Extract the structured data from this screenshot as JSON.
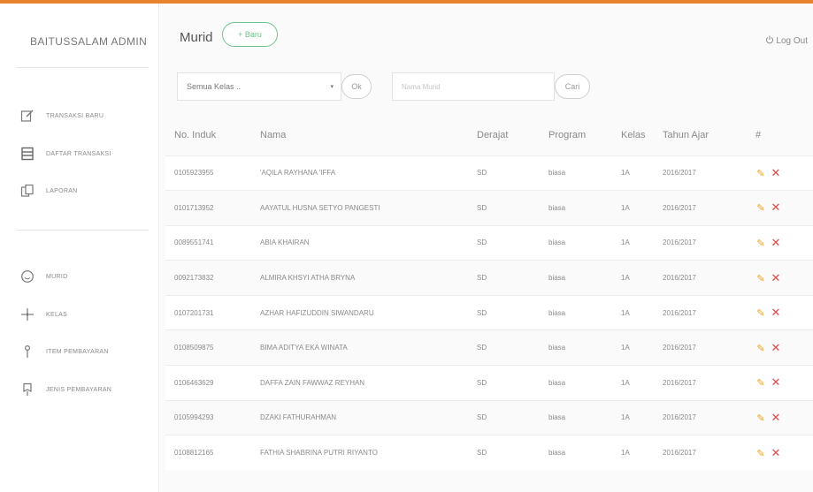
{
  "colors": {
    "accent": "#e8822e",
    "new_button": "#6dc48a",
    "edit": "#e8a21e",
    "delete": "#e04747"
  },
  "sidebar": {
    "brand": "BAITUSSALAM ADMIN",
    "items": [
      {
        "label": "TRANSAKSI BARU",
        "icon": "edit-document-icon"
      },
      {
        "label": "DAFTAR TRANSAKSI",
        "icon": "list-icon"
      },
      {
        "label": "LAPORAN",
        "icon": "report-icon"
      },
      {
        "label": "MURID",
        "icon": "smile-icon"
      },
      {
        "label": "KELAS",
        "icon": "class-icon"
      },
      {
        "label": "ITEM PEMBAYARAN",
        "icon": "pin-icon"
      },
      {
        "label": "JENIS PEMBAYARAN",
        "icon": "bookmark-icon"
      }
    ]
  },
  "header": {
    "title": "Murid",
    "new_button": "+ Baru",
    "logout": "Log Out"
  },
  "filters": {
    "class_select": "Semua Kelas ..",
    "ok_button": "Ok",
    "search_placeholder": "Nama Murid",
    "search_button": "Cari"
  },
  "table": {
    "headers": [
      "No. Induk",
      "Nama",
      "Derajat",
      "Program",
      "Kelas",
      "Tahun Ajar",
      "#"
    ],
    "rows": [
      {
        "no": "0105923955",
        "nama": "'AQILA RAYHANA 'IFFA",
        "derajat": "SD",
        "program": "biasa",
        "kelas": "1A",
        "tahun": "2016/2017"
      },
      {
        "no": "0101713952",
        "nama": "AAYATUL HUSNA SETYO PANGESTI",
        "derajat": "SD",
        "program": "biasa",
        "kelas": "1A",
        "tahun": "2016/2017"
      },
      {
        "no": "0089551741",
        "nama": "ABIA KHAIRAN",
        "derajat": "SD",
        "program": "biasa",
        "kelas": "1A",
        "tahun": "2016/2017"
      },
      {
        "no": "0092173832",
        "nama": "ALMIRA KHSYI ATHA BRYNA",
        "derajat": "SD",
        "program": "biasa",
        "kelas": "1A",
        "tahun": "2016/2017"
      },
      {
        "no": "0107201731",
        "nama": "AZHAR HAFIZUDDIN SIWANDARU",
        "derajat": "SD",
        "program": "biasa",
        "kelas": "1A",
        "tahun": "2016/2017"
      },
      {
        "no": "0108509875",
        "nama": "BIMA ADITYA EKA WINATA",
        "derajat": "SD",
        "program": "biasa",
        "kelas": "1A",
        "tahun": "2016/2017"
      },
      {
        "no": "0106463629",
        "nama": "DAFFA ZAIN FAWWAZ REYHAN",
        "derajat": "SD",
        "program": "biasa",
        "kelas": "1A",
        "tahun": "2016/2017"
      },
      {
        "no": "0105994293",
        "nama": "DZAKI FATHURAHMAN",
        "derajat": "SD",
        "program": "biasa",
        "kelas": "1A",
        "tahun": "2016/2017"
      },
      {
        "no": "0108812165",
        "nama": "FATHIA SHABRINA PUTRI RIYANTO",
        "derajat": "SD",
        "program": "biasa",
        "kelas": "1A",
        "tahun": "2016/2017"
      }
    ]
  }
}
